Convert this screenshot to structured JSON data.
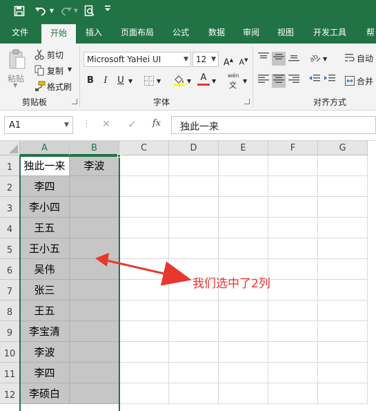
{
  "title_bar": {
    "quick_access": [
      "save-icon",
      "undo-icon",
      "redo-icon",
      "print-preview-icon",
      "customize-icon"
    ]
  },
  "tabs": [
    {
      "label": "文件",
      "active": false
    },
    {
      "label": "开始",
      "active": true
    },
    {
      "label": "插入",
      "active": false
    },
    {
      "label": "页面布局",
      "active": false
    },
    {
      "label": "公式",
      "active": false
    },
    {
      "label": "数据",
      "active": false
    },
    {
      "label": "审阅",
      "active": false
    },
    {
      "label": "视图",
      "active": false
    },
    {
      "label": "开发工具",
      "active": false
    },
    {
      "label": "帮",
      "active": false
    }
  ],
  "ribbon": {
    "clipboard": {
      "paste": "粘贴",
      "cut": "剪切",
      "copy": "复制",
      "format_painter": "格式刷",
      "group_label": "剪贴板"
    },
    "font": {
      "font_name": "Microsoft YaHei UI",
      "font_size": "12",
      "grow": "A",
      "shrink": "A",
      "bold": "B",
      "italic": "I",
      "underline": "U",
      "font_color_letter": "A",
      "phonetic_top": "wén",
      "phonetic_bottom": "文",
      "group_label": "字体"
    },
    "alignment": {
      "wrap": "自动",
      "merge": "合并",
      "group_label": "对齐方式"
    }
  },
  "formula_bar": {
    "name_box": "A1",
    "fx": "fx",
    "content": "独此一来"
  },
  "columns": [
    "A",
    "B",
    "C",
    "D",
    "E",
    "F",
    "G"
  ],
  "rows": [
    "1",
    "2",
    "3",
    "4",
    "5",
    "6",
    "7",
    "8",
    "9",
    "10",
    "11",
    "12"
  ],
  "column_a": [
    "独此一来",
    "李四",
    "李小四",
    "王五",
    "王小五",
    "吴伟",
    "张三",
    "王五",
    "李宝清",
    "李波",
    "李四",
    "李硕白"
  ],
  "column_b": [
    "李波",
    "",
    "",
    "",
    "",
    "",
    "",
    "",
    "",
    "",
    "",
    ""
  ],
  "annotation": {
    "text": "我们选中了2列",
    "color": "#e8372d"
  },
  "colors": {
    "excel_green": "#217346",
    "selection_gray": "#c6c6c6",
    "ribbon_bg": "#f3f3f3"
  }
}
